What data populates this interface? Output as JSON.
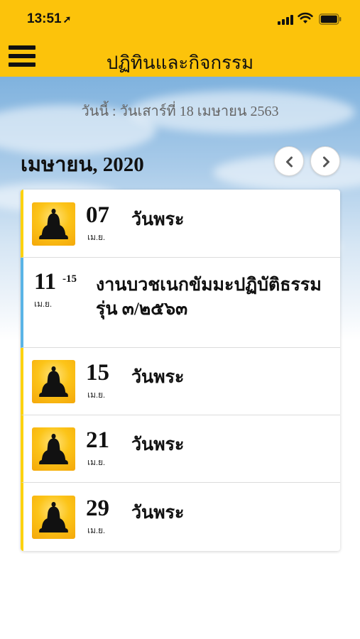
{
  "status_bar": {
    "time": "13:51",
    "location_arrow": "➚"
  },
  "header": {
    "title": "ปฏิทินและกิจกรรม",
    "menu_icon": "hamburger-icon"
  },
  "today_label": "วันนี้ : วันเสาร์ที่ 18 เมษายน 2563",
  "month_label": "เมษายน, 2020",
  "nav": {
    "prev_icon": "chevron-left-icon",
    "next_icon": "chevron-right-icon"
  },
  "events": [
    {
      "day": "07",
      "month": "เม.ย.",
      "title": "วันพระ",
      "icon": "buddha-icon",
      "accent": "#fcd20f"
    },
    {
      "day": "11",
      "range_end": "-15",
      "month": "เม.ย.",
      "title": "งานบวชเนกขัมมะปฏิบัติธรรม รุ่น ๓/๒๕๖๓",
      "accent": "#5ab4e6"
    },
    {
      "day": "15",
      "month": "เม.ย.",
      "title": "วันพระ",
      "icon": "buddha-icon",
      "accent": "#fcd20f"
    },
    {
      "day": "21",
      "month": "เม.ย.",
      "title": "วันพระ",
      "icon": "buddha-icon",
      "accent": "#fcd20f"
    },
    {
      "day": "29",
      "month": "เม.ย.",
      "title": "วันพระ",
      "icon": "buddha-icon",
      "accent": "#fcd20f"
    }
  ],
  "colors": {
    "header_bg": "#fcc30b",
    "text": "#111111",
    "muted": "#666666"
  }
}
